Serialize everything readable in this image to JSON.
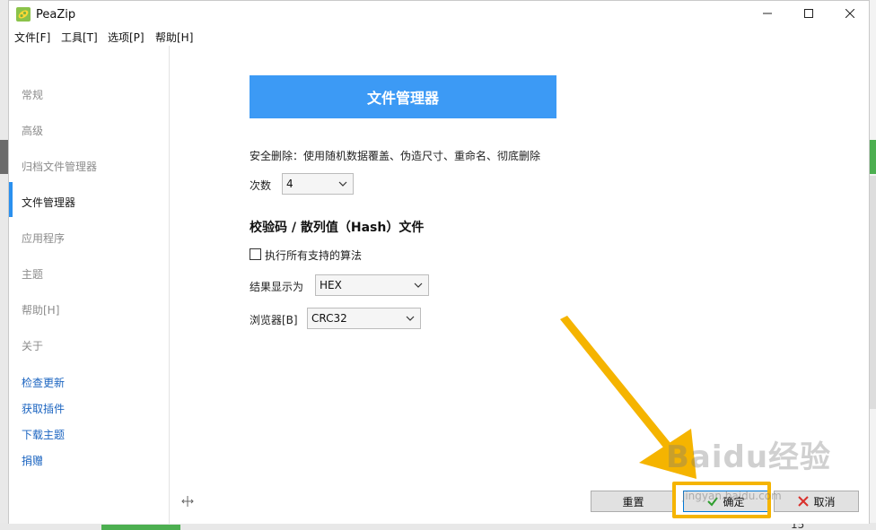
{
  "window": {
    "title": "PeaZip"
  },
  "menu": [
    "文件[F]",
    "工具[T]",
    "选项[P]",
    "帮助[H]"
  ],
  "sidebar": {
    "items": [
      "常规",
      "高级",
      "归档文件管理器",
      "文件管理器",
      "应用程序",
      "主题",
      "帮助[H]",
      "关于"
    ],
    "active_index": 3,
    "links": [
      "检查更新",
      "获取插件",
      "下载主题",
      "捐赠"
    ]
  },
  "main": {
    "header": "文件管理器",
    "secure_delete_text": "安全删除：使用随机数据覆盖、伪造尺寸、重命名、彻底删除",
    "passes_label": "次数",
    "passes_value": "4",
    "hash_section_title": "校验码 / 散列值（Hash）文件",
    "all_algorithms_label": "执行所有支持的算法",
    "display_result_label": "结果显示为",
    "display_result_value": "HEX",
    "browser_label": "浏览器[B]",
    "browser_value": "CRC32"
  },
  "buttons": {
    "reset": "重置",
    "ok": "确定",
    "cancel": "取消"
  },
  "overlay": {
    "watermark": "Baidu经验",
    "watermark_sub": "jingyan.baidu.com"
  },
  "background": {
    "bottom_number": "15"
  },
  "colors": {
    "accent": "#3c9af5",
    "active_bar": "#2a90ef",
    "link": "#1b64c0",
    "highlight": "#f5b400"
  },
  "icons": [
    "peazip-app-icon",
    "minimize-icon",
    "maximize-icon",
    "close-icon",
    "chevron-down-icon",
    "checkmark-icon",
    "cross-icon",
    "move-icon"
  ]
}
